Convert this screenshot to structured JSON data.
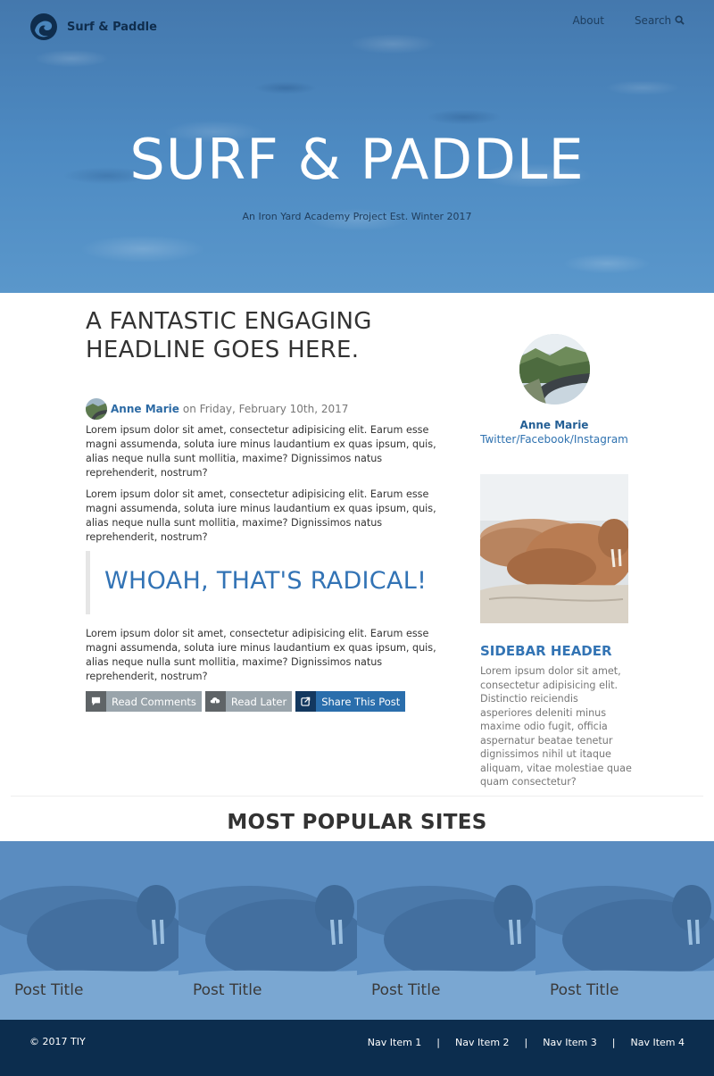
{
  "brand": {
    "name": "Surf & Paddle",
    "logo_icon": "wave-logo-icon"
  },
  "top_nav": {
    "about": "About",
    "search": "Search",
    "search_icon": "search-icon"
  },
  "hero": {
    "title": "SURF & PADDLE",
    "subtitle": "An Iron Yard Academy Project Est. Winter 2017"
  },
  "article": {
    "headline": "A FANTASTIC ENGAGING HEADLINE GOES HERE.",
    "author": "Anne Marie",
    "date_text": "on Friday, February 10th, 2017",
    "paragraph1": "Lorem ipsum dolor sit amet, consectetur adipisicing elit. Earum esse magni assumenda, soluta iure minus laudantium ex quas ipsum, quis, alias neque nulla sunt mollitia, maxime? Dignissimos natus reprehenderit, nostrum?",
    "paragraph2": "Lorem ipsum dolor sit amet, consectetur adipisicing elit. Earum esse magni assumenda, soluta iure minus laudantium ex quas ipsum, quis, alias neque nulla sunt mollitia, maxime? Dignissimos natus reprehenderit, nostrum?",
    "quote": "WHOAH, THAT'S RADICAL!",
    "paragraph3": "Lorem ipsum dolor sit amet, consectetur adipisicing elit. Earum esse magni assumenda, soluta iure minus laudantium ex quas ipsum, quis, alias neque nulla sunt mollitia, maxime? Dignissimos natus reprehenderit, nostrum?",
    "actions": {
      "read_comments": "Read Comments",
      "read_later": "Read Later",
      "share": "Share This Post"
    }
  },
  "sidebar": {
    "author_name": "Anne Marie",
    "social": "Twitter/Facebook/Instagram",
    "header": "SIDEBAR HEADER",
    "text": "Lorem ipsum dolor sit amet, consectetur adipisicing elit. Distinctio reiciendis asperiores deleniti minus maxime odio fugit, officia aspernatur beatae tenetur dignissimos nihil ut itaque aliquam, vitae molestiae quae quam consectetur?"
  },
  "popular": {
    "title": "MOST POPULAR SITES",
    "tiles": [
      {
        "title": "Post Title"
      },
      {
        "title": "Post Title"
      },
      {
        "title": "Post Title"
      },
      {
        "title": "Post Title"
      }
    ]
  },
  "footer": {
    "copyright": "© 2017 TIY",
    "nav": [
      "Nav Item 1",
      "Nav Item 2",
      "Nav Item 3",
      "Nav Item 4"
    ],
    "separator": "|"
  },
  "colors": {
    "accent": "#2c6aa4",
    "hero_blue": "#4a86bd",
    "footer_navy": "#0c2d4e",
    "quote_blue": "#3273b5"
  }
}
